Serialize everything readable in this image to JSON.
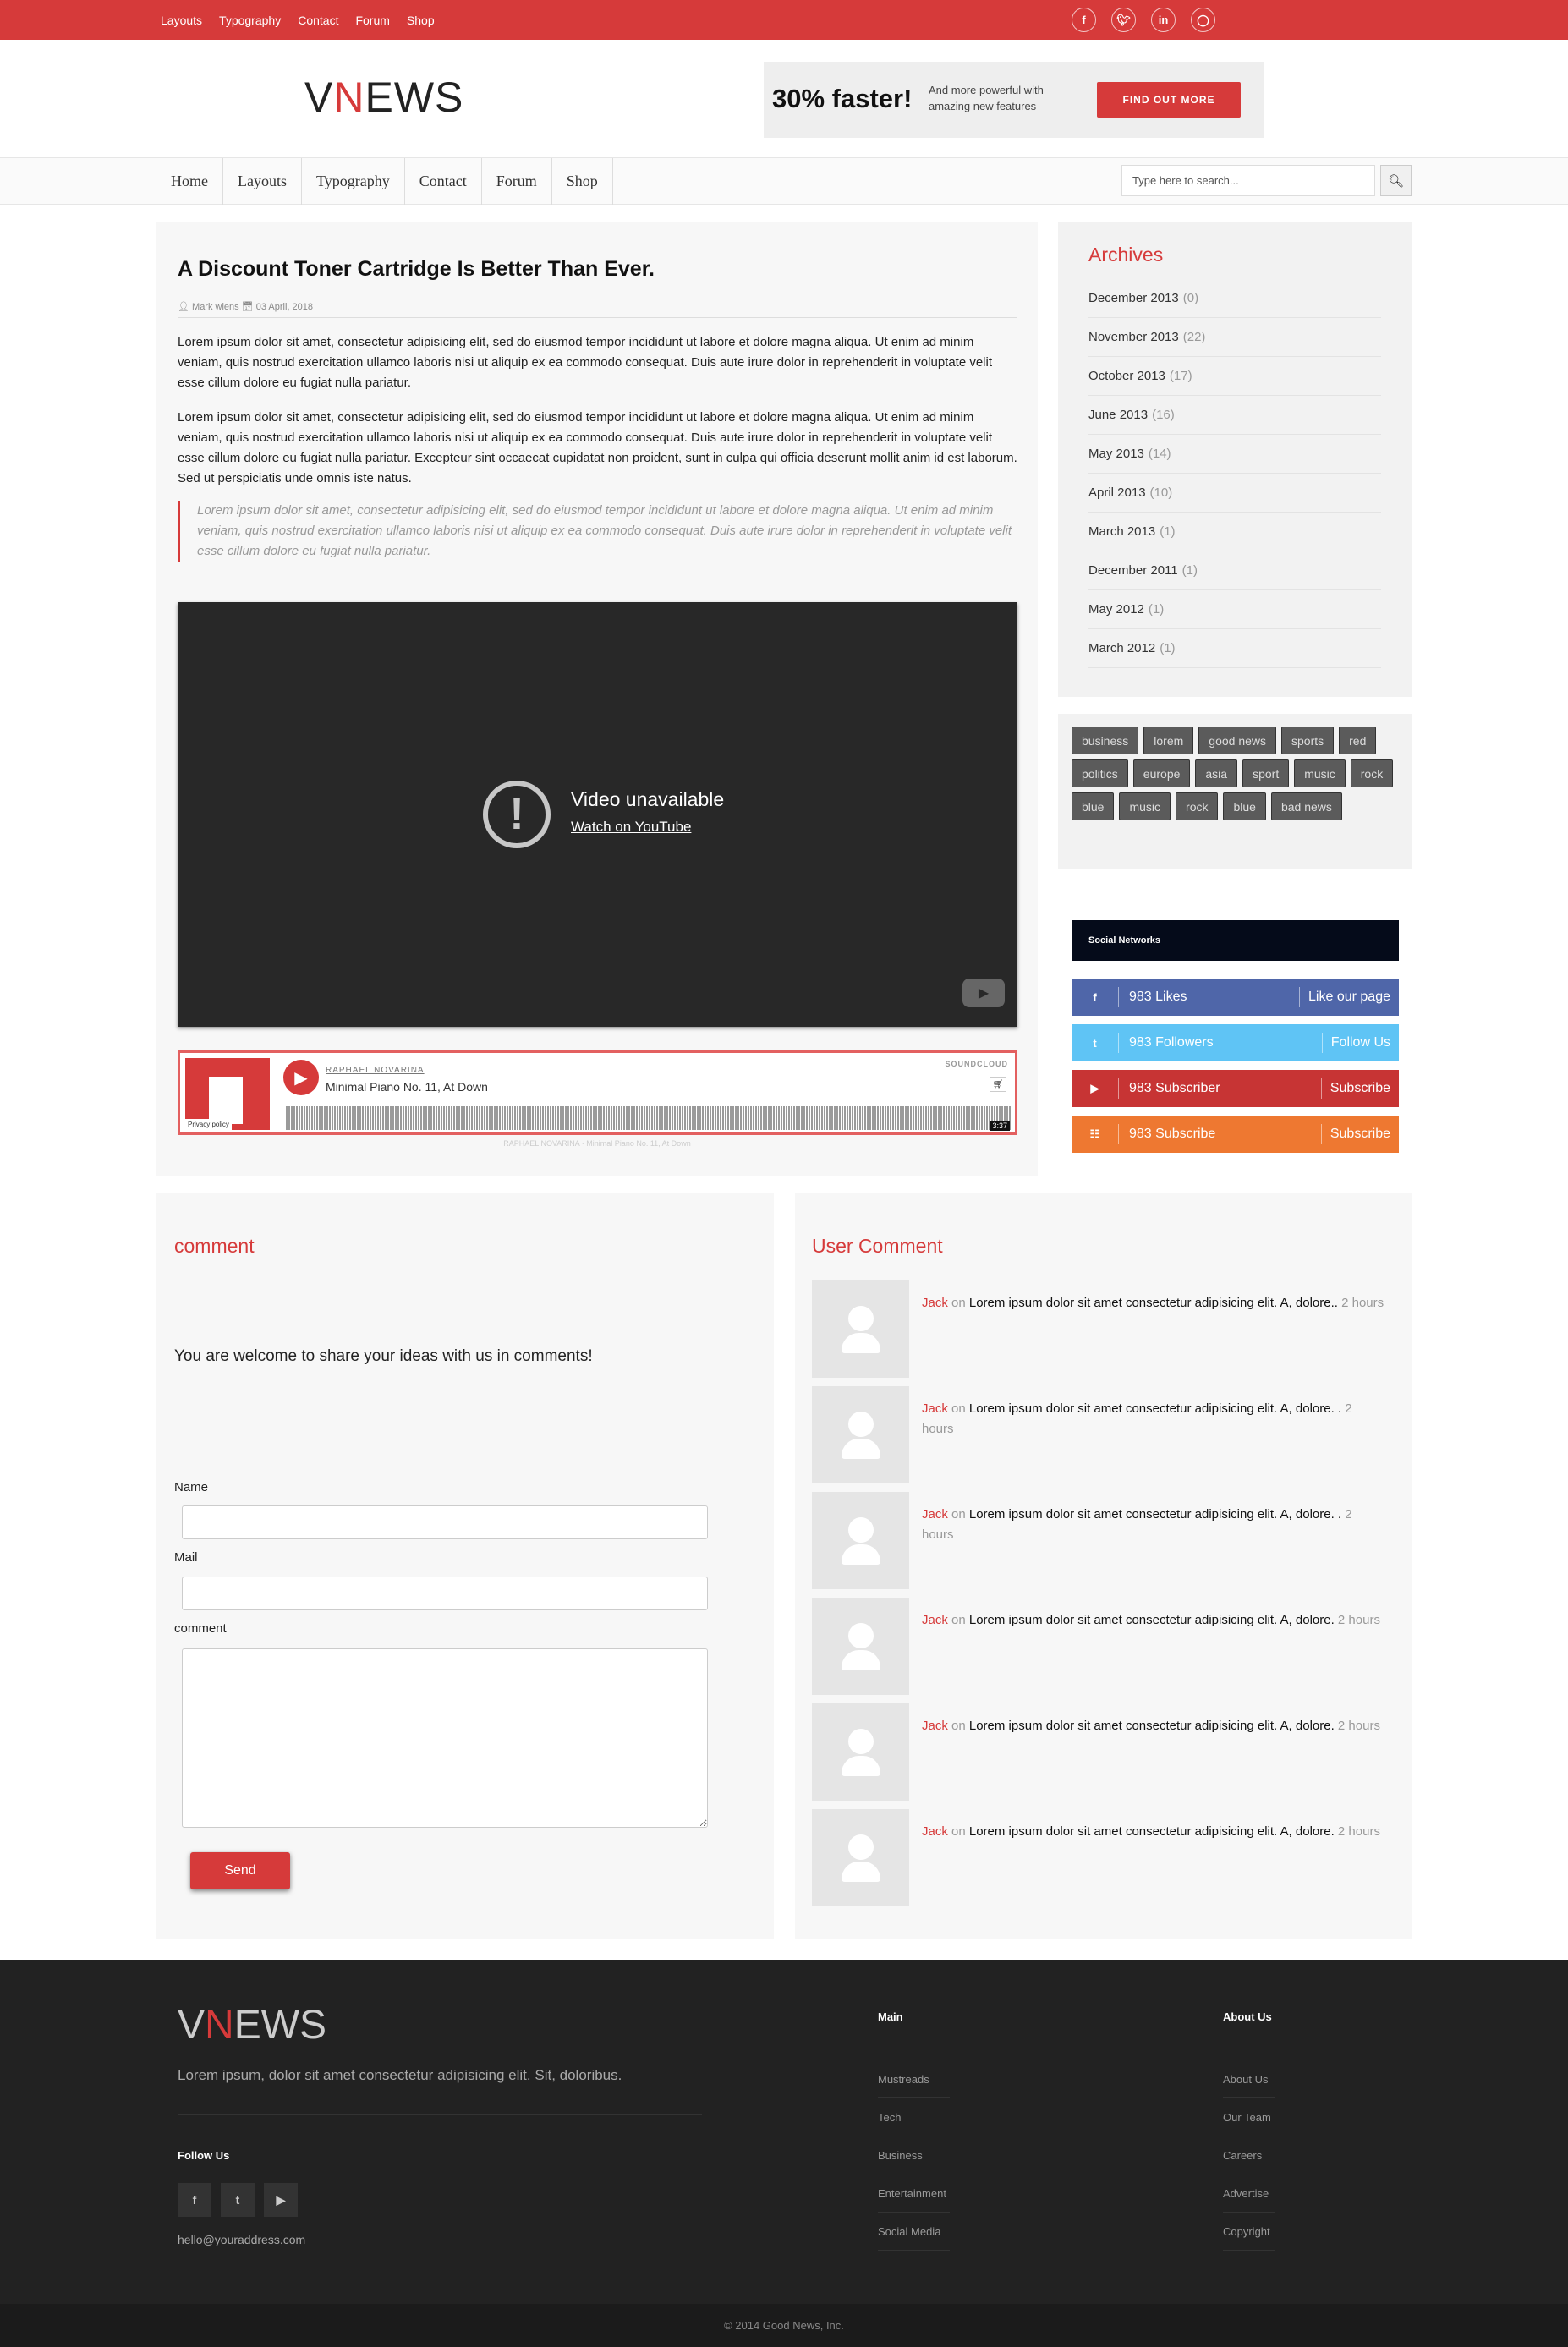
{
  "topbar": {
    "links": [
      "Layouts",
      "Typography",
      "Contact",
      "Forum",
      "Shop"
    ],
    "social_icons": [
      "facebook-icon",
      "twitter-icon",
      "linkedin-icon",
      "instagram-icon"
    ],
    "color": "#d63a3a"
  },
  "header": {
    "logo_v": "V",
    "logo_n": "N",
    "logo_rest": "EWS",
    "ad": {
      "headline": "30% faster!",
      "text": "And more powerful with amazing new features",
      "button": "FIND OUT MORE"
    }
  },
  "nav": {
    "items": [
      "Home",
      "Layouts",
      "Typography",
      "Contact",
      "Forum",
      "Shop"
    ],
    "search_placeholder": "Type here to search..."
  },
  "article": {
    "title": "A Discount Toner Cartridge Is Better Than Ever.",
    "author": "Mark wiens",
    "date": "03 April, 2018",
    "paragraph1": "Lorem ipsum dolor sit amet, consectetur adipisicing elit, sed do eiusmod tempor incididunt ut labore et dolore magna aliqua. Ut enim ad minim veniam, quis nostrud exercitation ullamco laboris nisi ut aliquip ex ea commodo consequat. Duis aute irure dolor in reprehenderit in voluptate velit esse cillum dolore eu fugiat nulla pariatur.",
    "paragraph2": "Lorem ipsum dolor sit amet, consectetur adipisicing elit, sed do eiusmod tempor incididunt ut labore et dolore magna aliqua. Ut enim ad minim veniam, quis nostrud exercitation ullamco laboris nisi ut aliquip ex ea commodo consequat. Duis aute irure dolor in reprehenderit in voluptate velit esse cillum dolore eu fugiat nulla pariatur. Excepteur sint occaecat cupidatat non proident, sunt in culpa qui officia deserunt mollit anim id est laborum. Sed ut perspiciatis unde omnis iste natus.",
    "quote": "Lorem ipsum dolor sit amet, consectetur adipisicing elit, sed do eiusmod tempor incididunt ut labore et dolore magna aliqua. Ut enim ad minim veniam, quis nostrud exercitation ullamco laboris nisi ut aliquip ex ea commodo consequat. Duis aute irure dolor in reprehenderit in voluptate velit esse cillum dolore eu fugiat nulla pariatur.",
    "video": {
      "title": "Video unavailable",
      "link": "Watch on YouTube"
    },
    "audio": {
      "artist": "RAPHAEL NOVARINA",
      "track": "Minimal Piano No. 11, At Down",
      "brand": "SOUNDCLOUD",
      "privacy": "Privacy policy",
      "duration": "3:37",
      "caption": "RAPHAEL NOVARINA · Minimal Piano No. 11, At Down"
    }
  },
  "archives": {
    "title": "Archives",
    "items": [
      {
        "label": "December 2013",
        "count": "(0)"
      },
      {
        "label": "November 2013",
        "count": "(22)"
      },
      {
        "label": "October 2013",
        "count": "(17)"
      },
      {
        "label": "June 2013",
        "count": "(16)"
      },
      {
        "label": "May 2013",
        "count": "(14)"
      },
      {
        "label": "April 2013",
        "count": "(10)"
      },
      {
        "label": "March 2013",
        "count": "(1)"
      },
      {
        "label": "December 2011",
        "count": "(1)"
      },
      {
        "label": "May 2012",
        "count": "(1)"
      },
      {
        "label": "March 2012",
        "count": "(1)"
      }
    ]
  },
  "tags": [
    "business",
    "lorem",
    "good news",
    "sports",
    "red",
    "politics",
    "europe",
    "asia",
    "sport",
    "music",
    "rock",
    "blue",
    "music",
    "rock",
    "blue",
    "bad news"
  ],
  "social_networks": {
    "title": "Social Networks",
    "rows": [
      {
        "icon": "facebook-icon",
        "count": "983 Likes",
        "action": "Like our page",
        "color": "#4f66a9"
      },
      {
        "icon": "twitter-icon",
        "count": "983 Followers",
        "action": "Follow Us",
        "color": "#5fc4f5"
      },
      {
        "icon": "youtube-icon",
        "count": "983 Subscriber",
        "action": "Subscribe",
        "color": "#c73434"
      },
      {
        "icon": "rss-icon",
        "count": "983 Subscribe",
        "action": "Subscribe",
        "color": "#ee7831"
      }
    ]
  },
  "comment_form": {
    "title": "comment",
    "intro": "You are welcome to share your ideas with us in comments!",
    "name_label": "Name",
    "mail_label": "Mail",
    "comment_label": "comment",
    "send": "Send"
  },
  "user_comments": {
    "title": "User Comment",
    "items": [
      {
        "name": "Jack",
        "on": "on",
        "text": "Lorem ipsum dolor sit amet consectetur adipisicing elit. A, dolore..",
        "time": "2 hours"
      },
      {
        "name": "Jack",
        "on": "on",
        "text": "Lorem ipsum dolor sit amet consectetur adipisicing elit. A, dolore. .",
        "time": "2 hours"
      },
      {
        "name": "Jack",
        "on": "on",
        "text": "Lorem ipsum dolor sit amet consectetur adipisicing elit. A, dolore. .",
        "time": "2 hours"
      },
      {
        "name": "Jack",
        "on": "on",
        "text": "Lorem ipsum dolor sit amet consectetur adipisicing elit. A, dolore.",
        "time": "2 hours"
      },
      {
        "name": "Jack",
        "on": "on",
        "text": "Lorem ipsum dolor sit amet consectetur adipisicing elit. A, dolore.",
        "time": "2 hours"
      },
      {
        "name": "Jack",
        "on": "on",
        "text": "Lorem ipsum dolor sit amet consectetur adipisicing elit. A, dolore.",
        "time": "2 hours"
      }
    ]
  },
  "footer": {
    "logo_v": "V",
    "logo_n": "N",
    "logo_rest": "EWS",
    "description": "Lorem ipsum, dolor sit amet consectetur adipisicing elit. Sit, doloribus.",
    "follow_title": "Follow Us",
    "follow_icons": [
      "facebook-icon",
      "twitter-icon",
      "youtube-icon"
    ],
    "email": "hello@youraddress.com",
    "main_title": "Main",
    "main_links": [
      "Mustreads",
      "Tech",
      "Business",
      "Entertainment",
      "Social Media"
    ],
    "about_title": "About Us",
    "about_links": [
      "About Us",
      "Our Team",
      "Careers",
      "Advertise",
      "Copyright"
    ],
    "copyright": "© 2014 Good News, Inc."
  }
}
